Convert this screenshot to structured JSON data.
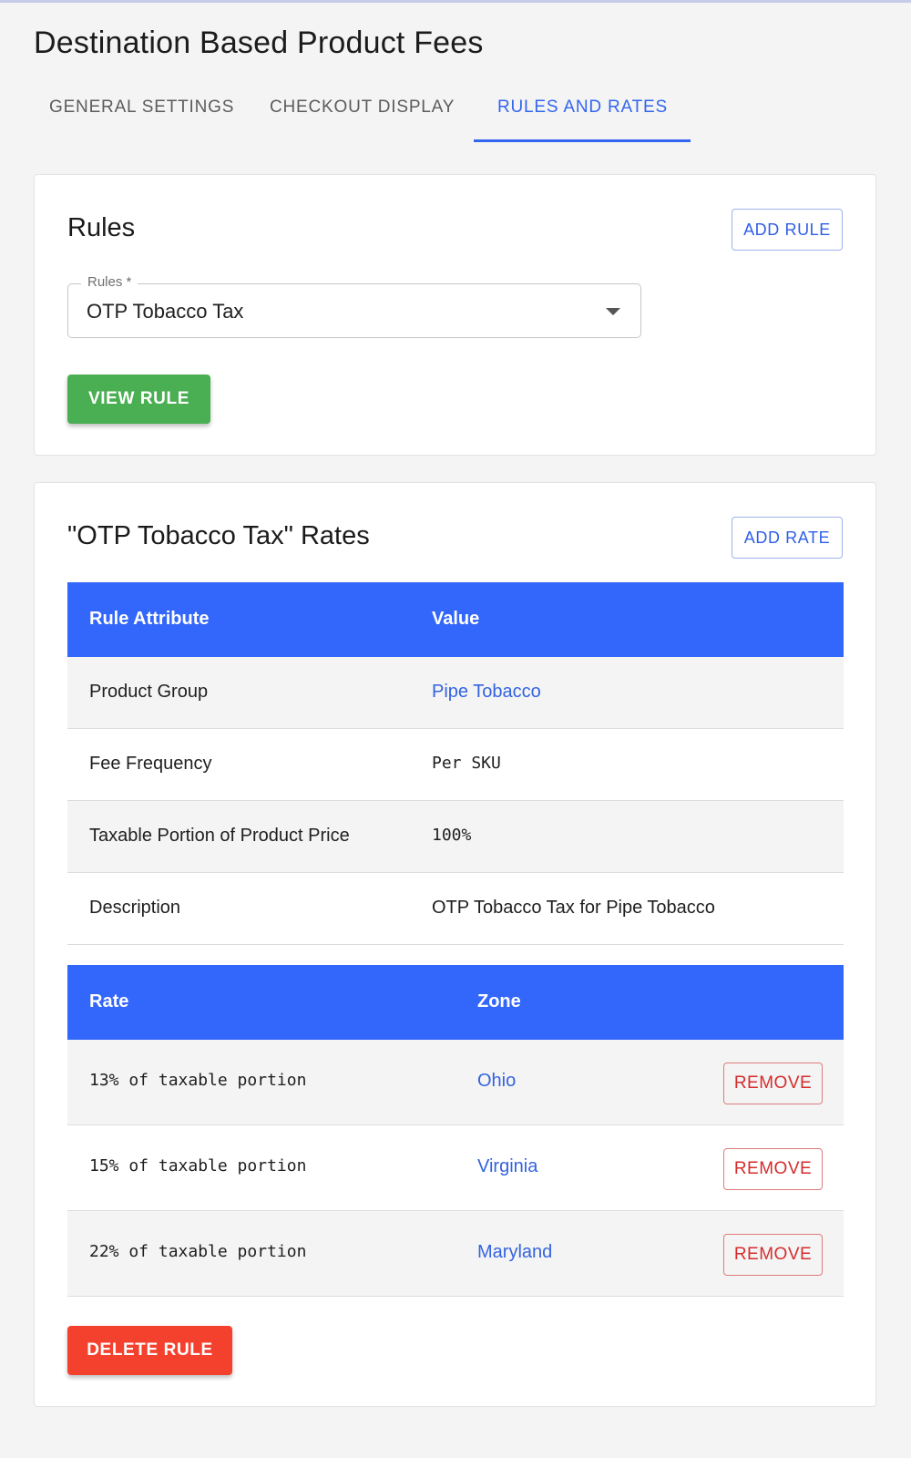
{
  "page": {
    "title": "Destination Based Product Fees"
  },
  "tabs": [
    {
      "label": "GENERAL SETTINGS"
    },
    {
      "label": "CHECKOUT DISPLAY"
    },
    {
      "label": "RULES AND RATES",
      "active": true
    }
  ],
  "rules_card": {
    "title": "Rules",
    "add_button": "ADD RULE",
    "select": {
      "label": "Rules *",
      "value": "OTP Tobacco Tax"
    },
    "view_button": "VIEW RULE"
  },
  "rates_card": {
    "title": "\"OTP Tobacco Tax\" Rates",
    "add_button": "ADD RATE",
    "attributes_table": {
      "headers": [
        "Rule Attribute",
        "Value"
      ],
      "rows": [
        {
          "attribute": "Product Group",
          "value": "Pipe Tobacco"
        },
        {
          "attribute": "Fee Frequency",
          "value": "Per SKU"
        },
        {
          "attribute": "Taxable Portion of Product Price",
          "value": "100%"
        },
        {
          "attribute": "Description",
          "value": "OTP Tobacco Tax for Pipe Tobacco"
        }
      ]
    },
    "rates_table": {
      "headers": [
        "Rate",
        "Zone"
      ],
      "rows": [
        {
          "rate": "13% of taxable portion",
          "zone": "Ohio",
          "action": "REMOVE"
        },
        {
          "rate": "15% of taxable portion",
          "zone": "Virginia",
          "action": "REMOVE"
        },
        {
          "rate": "22% of taxable portion",
          "zone": "Maryland",
          "action": "REMOVE"
        }
      ]
    },
    "delete_button": "DELETE RULE"
  },
  "colors": {
    "accent": "#3366fa",
    "success": "#4aae52",
    "danger": "#f4412e",
    "link": "#3363e0"
  }
}
